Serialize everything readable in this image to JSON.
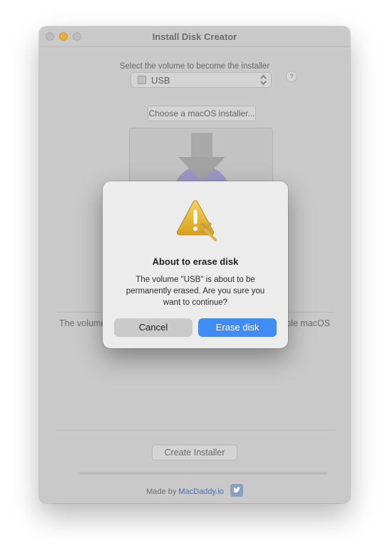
{
  "window": {
    "title": "Install Disk Creator"
  },
  "volume_selector": {
    "label": "Select the volume to become the installer",
    "selected": "USB",
    "help": "?"
  },
  "installer": {
    "choose_label": "Choose a macOS installer..."
  },
  "volume_note": {
    "visible_left": "The volume",
    "visible_right": "ble macOS"
  },
  "create_button": "Create Installer",
  "progress": {
    "value": 0
  },
  "footer": {
    "prefix": "Made by",
    "link": "MacDaddy.io"
  },
  "dialog": {
    "title": "About to erase disk",
    "message": "The volume \"USB\" is about to be permanently erased. Are you sure you want to continue?",
    "cancel_label": "Cancel",
    "confirm_label": "Erase disk"
  },
  "colors": {
    "accent": "#3f8cf4",
    "link": "#4c6fa8",
    "warning": "#e5b12f"
  }
}
